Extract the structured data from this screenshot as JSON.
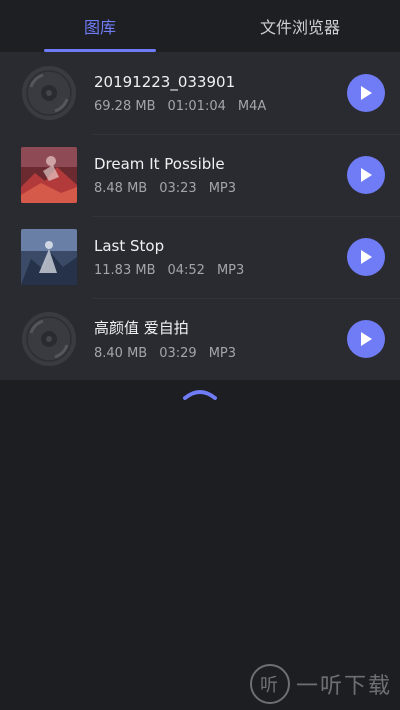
{
  "tabs": [
    {
      "label": "图库",
      "active": true
    },
    {
      "label": "文件浏览器",
      "active": false
    }
  ],
  "tracks": [
    {
      "title": "20191223_033901",
      "size": "69.28 MB",
      "duration": "01:01:04",
      "format": "M4A",
      "thumb": "disc-icon"
    },
    {
      "title": "Dream It Possible",
      "size": "8.48 MB",
      "duration": "03:23",
      "format": "MP3",
      "thumb": "album-art-red"
    },
    {
      "title": "Last Stop",
      "size": "11.83 MB",
      "duration": "04:52",
      "format": "MP3",
      "thumb": "album-art-blue"
    },
    {
      "title": "高颜值 爱自拍",
      "size": "8.40 MB",
      "duration": "03:29",
      "format": "MP3",
      "thumb": "disc-icon"
    }
  ],
  "collapse_icon": "chevron-up-icon",
  "watermark": {
    "text": "一听下载",
    "logo_text": "听"
  },
  "colors": {
    "accent": "#6f7cf5",
    "background": "#1d1e22",
    "list_bg": "#2a2b30"
  }
}
